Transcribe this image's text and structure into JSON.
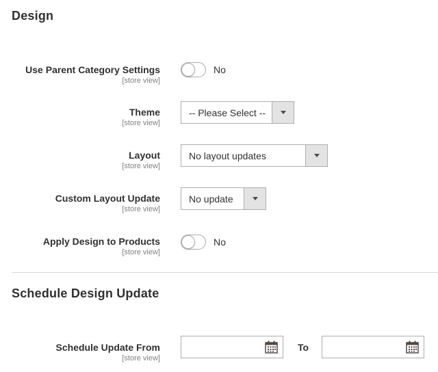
{
  "sections": {
    "design": {
      "title": "Design"
    },
    "schedule": {
      "title": "Schedule Design Update"
    }
  },
  "fields": {
    "use_parent": {
      "label": "Use Parent Category Settings",
      "scope": "[store view]",
      "value": "No"
    },
    "theme": {
      "label": "Theme",
      "scope": "[store view]",
      "value": "-- Please Select --"
    },
    "layout": {
      "label": "Layout",
      "scope": "[store view]",
      "value": "No layout updates"
    },
    "custom_layout": {
      "label": "Custom Layout Update",
      "scope": "[store view]",
      "value": "No update"
    },
    "apply_design": {
      "label": "Apply Design to Products",
      "scope": "[store view]",
      "value": "No"
    },
    "schedule_from": {
      "label": "Schedule Update From",
      "scope": "[store view]",
      "from_value": "",
      "to_label": "To",
      "to_value": ""
    }
  },
  "icons": {
    "toggle": "toggle-switch",
    "dropdown": "chevron-down-icon",
    "calendar": "calendar-icon"
  },
  "colors": {
    "text": "#303030",
    "scope_text": "#808080",
    "border": "#adadad",
    "select_button_bg": "#e3e3e3"
  }
}
